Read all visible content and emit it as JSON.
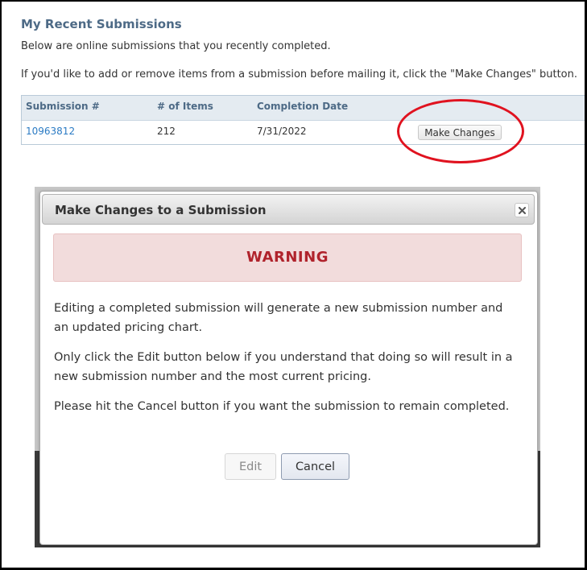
{
  "page": {
    "title": "My Recent Submissions",
    "intro_1": "Below are online submissions that you recently completed.",
    "intro_2": "If you'd like to add or remove items from a submission before mailing it, click the \"Make Changes\" button."
  },
  "table": {
    "headers": [
      "Submission #",
      "# of Items",
      "Completion Date"
    ],
    "rows": [
      {
        "submission": "10963812",
        "items": "212",
        "date": "7/31/2022",
        "action": "Make Changes"
      }
    ]
  },
  "dialog": {
    "title": "Make Changes to a Submission",
    "close_icon": "close-icon",
    "warning": "WARNING",
    "paragraphs": [
      "Editing a completed submission will generate a new submission number and an updated pricing chart.",
      "Only click the Edit button below if you understand that doing so will result in a new submission number and the most current pricing.",
      "Please hit the Cancel button if you want the submission to remain completed."
    ],
    "edit_label": "Edit",
    "cancel_label": "Cancel"
  },
  "colors": {
    "heading": "#4d6a86",
    "link": "#2b7bc4",
    "warning_bg": "#f2dcdc",
    "warning_text": "#b0232c",
    "annotation_circle": "#e0121f"
  }
}
